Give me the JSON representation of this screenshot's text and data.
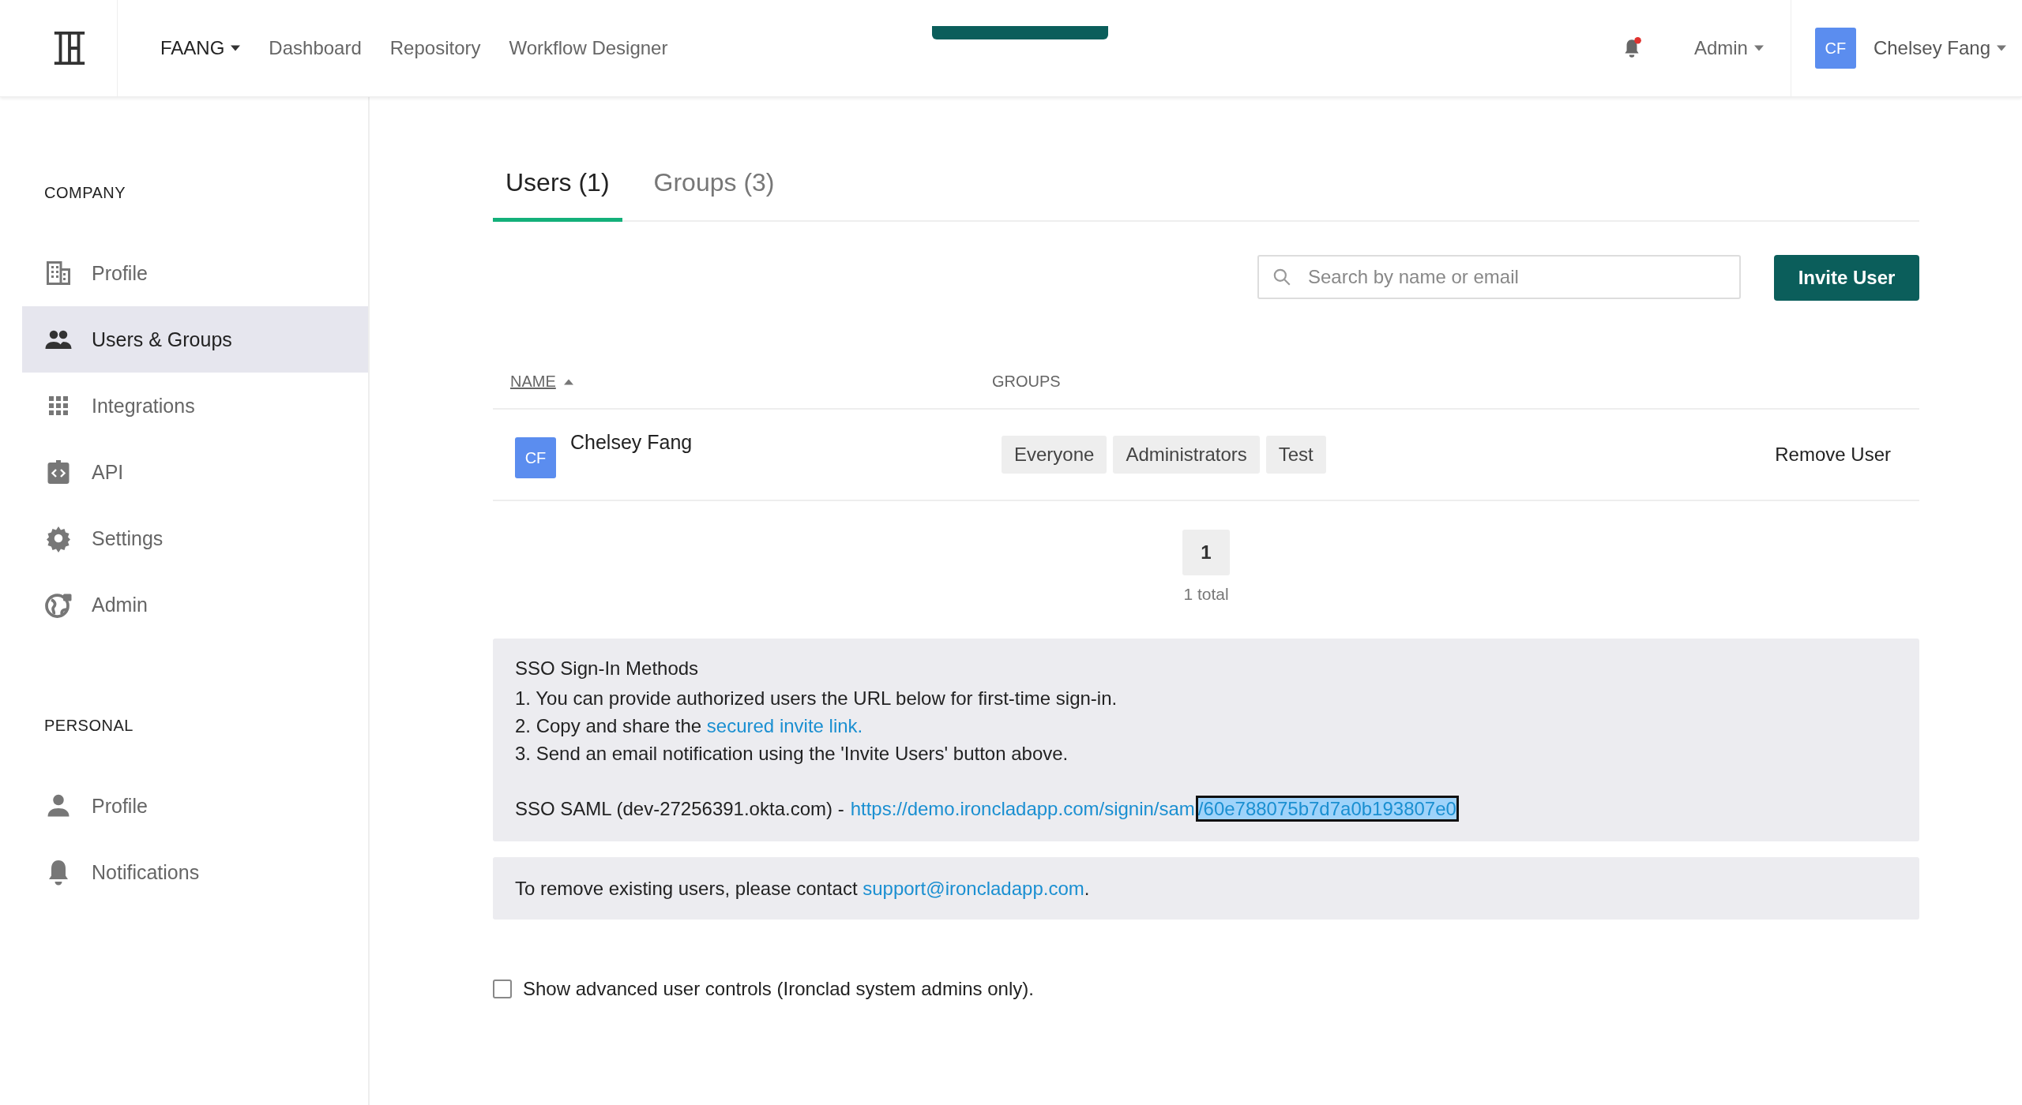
{
  "topbar": {
    "nav": [
      {
        "label": "FAANG",
        "dropdown": true
      },
      {
        "label": "Dashboard",
        "dropdown": false
      },
      {
        "label": "Repository",
        "dropdown": false
      },
      {
        "label": "Workflow Designer",
        "dropdown": false
      }
    ],
    "notification_unread": true,
    "admin_menu": "Admin",
    "user": {
      "initials": "CF",
      "name": "Chelsey Fang"
    }
  },
  "sidebar": {
    "sections": [
      {
        "title": "COMPANY",
        "items": [
          {
            "label": "Profile",
            "kind": "building",
            "selected": false
          },
          {
            "label": "Users & Groups",
            "kind": "users",
            "selected": true
          },
          {
            "label": "Integrations",
            "kind": "grid",
            "selected": false
          },
          {
            "label": "API",
            "kind": "api",
            "selected": false
          },
          {
            "label": "Settings",
            "kind": "gear",
            "selected": false
          },
          {
            "label": "Admin",
            "kind": "globe",
            "selected": false
          }
        ]
      },
      {
        "title": "PERSONAL",
        "items": [
          {
            "label": "Profile",
            "kind": "person",
            "selected": false
          },
          {
            "label": "Notifications",
            "kind": "bell",
            "selected": false
          }
        ]
      }
    ]
  },
  "tabs": [
    {
      "label": "Users (1)",
      "selected": true
    },
    {
      "label": "Groups (3)",
      "selected": false
    }
  ],
  "search": {
    "placeholder": "Search by name or email"
  },
  "invite_button": "Invite User",
  "table": {
    "columns": [
      {
        "label": "NAME",
        "sorted": true
      },
      {
        "label": "GROUPS",
        "sorted": false
      }
    ],
    "rows": [
      {
        "initials": "CF",
        "name": "Chelsey Fang",
        "groups": [
          "Everyone",
          "Administrators",
          "Test"
        ],
        "action": "Remove User"
      }
    ]
  },
  "pagination": {
    "pages": [
      {
        "label": "1",
        "selected": true
      }
    ],
    "total": "1 total"
  },
  "sso": {
    "title": "SSO Sign-In Methods",
    "lines": [
      {
        "text": "1. You can provide authorized users the URL below for first-time sign-in."
      },
      {
        "text": "2. Copy and share the",
        "link": "secured invite link."
      },
      {
        "text": "3. Send an email notification using the 'Invite Users' button above."
      }
    ],
    "saml_label": "SSO SAML (dev-27256391.okta.com) -",
    "link_segments": [
      {
        "text": "https://demo.ironcladapp.com/signin/sam",
        "highlighted": false
      },
      {
        "text": "/60e788075b7d7a0b193807e0",
        "highlighted": true
      }
    ]
  },
  "remove_notice": {
    "text": "To remove existing users, please contact",
    "email": "support@ironcladapp.com",
    "after": "."
  },
  "advanced_controls": {
    "label": "Show advanced user controls (Ironclad system admins only).",
    "checked": false
  }
}
